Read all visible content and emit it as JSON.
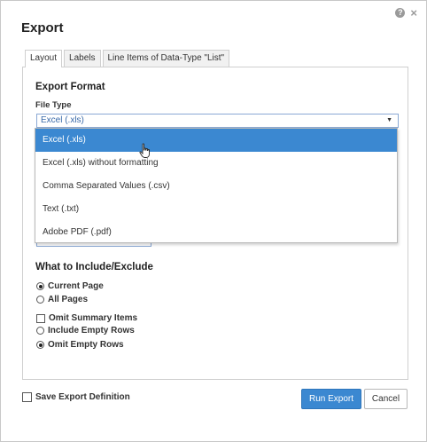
{
  "dialog": {
    "title": "Export",
    "help_icon": "?",
    "close_icon": "×"
  },
  "tabs": [
    {
      "label": "Layout",
      "active": true
    },
    {
      "label": "Labels",
      "active": false
    },
    {
      "label": "Line Items of Data-Type \"List\"",
      "active": false
    }
  ],
  "export_format": {
    "title": "Export Format",
    "file_type_label": "File Type",
    "selected": "Excel (.xls)",
    "options": [
      "Excel (.xls)",
      "Excel (.xls) without formatting",
      "Comma Separated Values (.csv)",
      "Text (.txt)",
      "Adobe PDF (.pdf)"
    ]
  },
  "include_exclude": {
    "title": "What to Include/Exclude",
    "pages": [
      {
        "label": "Current Page",
        "checked": true
      },
      {
        "label": "All Pages",
        "checked": false
      }
    ],
    "omit_summary": {
      "label": "Omit Summary Items",
      "checked": false
    },
    "rows": [
      {
        "label": "Include Empty Rows",
        "checked": false
      },
      {
        "label": "Omit Empty Rows",
        "checked": true
      }
    ]
  },
  "footer": {
    "save_definition_label": "Save Export Definition",
    "save_definition_checked": false,
    "run_export_label": "Run Export",
    "cancel_label": "Cancel"
  },
  "colors": {
    "accent": "#3b88d1",
    "select_border": "#8aa8d4",
    "selected_text": "#3a6aa9"
  }
}
